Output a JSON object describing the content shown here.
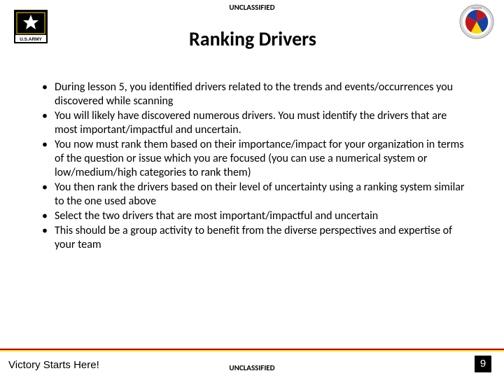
{
  "classification_top": "UNCLASSIFIED",
  "classification_bottom": "UNCLASSIFIED",
  "title": "Ranking Drivers",
  "bullets": [
    "During lesson 5, you identified drivers related to the trends and events/occurrences you discovered while scanning",
    "You will likely have discovered numerous drivers. You must identify the drivers that are most important/impactful and uncertain.",
    "You now must rank them based on their importance/impact for your organization in terms of the question or issue which you are focused (you can use a numerical system or low/medium/high categories to rank them)",
    "You then rank the drivers based on their level of uncertainty using a ranking system similar to the one used above",
    "Select the two drivers that are most important/impactful and uncertain",
    "This should be a group activity to benefit from the diverse perspectives and expertise of your team"
  ],
  "motto": "Victory Starts Here!",
  "page_number": "9",
  "logos": {
    "army_text": "U.S.ARMY",
    "unit_text": "HAMES"
  }
}
